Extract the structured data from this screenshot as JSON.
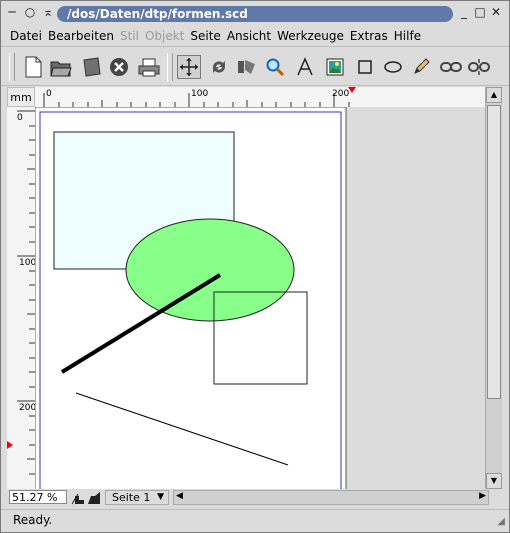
{
  "window": {
    "title": "/dos/Daten/dtp/formen.scd",
    "controls": [
      "minimize-icon",
      "maximize-icon",
      "close-icon"
    ]
  },
  "menu": {
    "items": [
      {
        "label": "Datei",
        "enabled": true
      },
      {
        "label": "Bearbeiten",
        "enabled": true
      },
      {
        "label": "Stil",
        "enabled": false
      },
      {
        "label": "Objekt",
        "enabled": false
      },
      {
        "label": "Seite",
        "enabled": true
      },
      {
        "label": "Ansicht",
        "enabled": true
      },
      {
        "label": "Werkzeuge",
        "enabled": true
      },
      {
        "label": "Extras",
        "enabled": true
      },
      {
        "label": "Hilfe",
        "enabled": true
      }
    ]
  },
  "toolbar": {
    "tools": [
      "new-document-icon",
      "open-folder-icon",
      "save-icon",
      "close-document-icon",
      "print-icon",
      "select-move-icon",
      "rotate-icon",
      "edit-contents-icon",
      "zoom-icon",
      "text-tool-icon",
      "image-tool-icon",
      "rectangle-tool-icon",
      "ellipse-tool-icon",
      "pencil-tool-icon",
      "link-frames-icon",
      "unlink-frames-icon"
    ]
  },
  "ruler": {
    "unit": "mm",
    "h_labels": [
      "0",
      "100",
      "200"
    ],
    "v_labels": [
      "0",
      "100",
      "200"
    ]
  },
  "bottom": {
    "zoom": "51.27 %",
    "page": "Seite 1"
  },
  "status": {
    "text": "Ready."
  },
  "colors": {
    "title_pill": "#6079a8",
    "ellipse_fill": "#88ff88",
    "rect_fill": "#eefdfd",
    "page_margin": "#3333cc",
    "ruler_marker": "#ff0000"
  }
}
